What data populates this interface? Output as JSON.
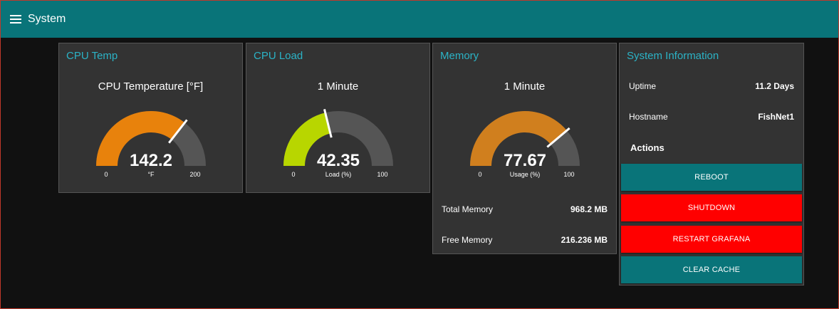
{
  "toolbar": {
    "title": "System"
  },
  "cpu_temp": {
    "title": "CPU Temp",
    "label": "CPU Temperature [°F]",
    "value": 142.2,
    "value_text": "142.2",
    "min": 0,
    "max": 200,
    "min_text": "0",
    "max_text": "200",
    "units": "°F",
    "fill_color": "#e8820c"
  },
  "cpu_load": {
    "title": "CPU Load",
    "label": "1 Minute",
    "value": 42.35,
    "value_text": "42.35",
    "min": 0,
    "max": 100,
    "min_text": "0",
    "max_text": "100",
    "units": "Load (%)",
    "fill_color": "#b8d600"
  },
  "memory": {
    "title": "Memory",
    "label": "1 Minute",
    "value": 77.67,
    "value_text": "77.67",
    "min": 0,
    "max": 100,
    "min_text": "0",
    "max_text": "100",
    "units": "Usage (%)",
    "fill_color": "#d07f1e",
    "total_label": "Total Memory",
    "total_value": "968.2 MB",
    "free_label": "Free Memory",
    "free_value": "216.236 MB"
  },
  "sysinfo": {
    "title": "System Information",
    "uptime_label": "Uptime",
    "uptime_value": "11.2 Days",
    "hostname_label": "Hostname",
    "hostname_value": "FishNet1",
    "actions_label": "Actions",
    "buttons": {
      "reboot": "REBOOT",
      "shutdown": "SHUTDOWN",
      "restart_grafana": "RESTART GRAFANA",
      "clear_cache": "CLEAR CACHE"
    }
  },
  "colors": {
    "toolbar": "#097479",
    "title_accent": "#2bb3c6",
    "gauge_track": "#555555",
    "btn_teal": "#097479",
    "btn_red": "#ff0000"
  }
}
